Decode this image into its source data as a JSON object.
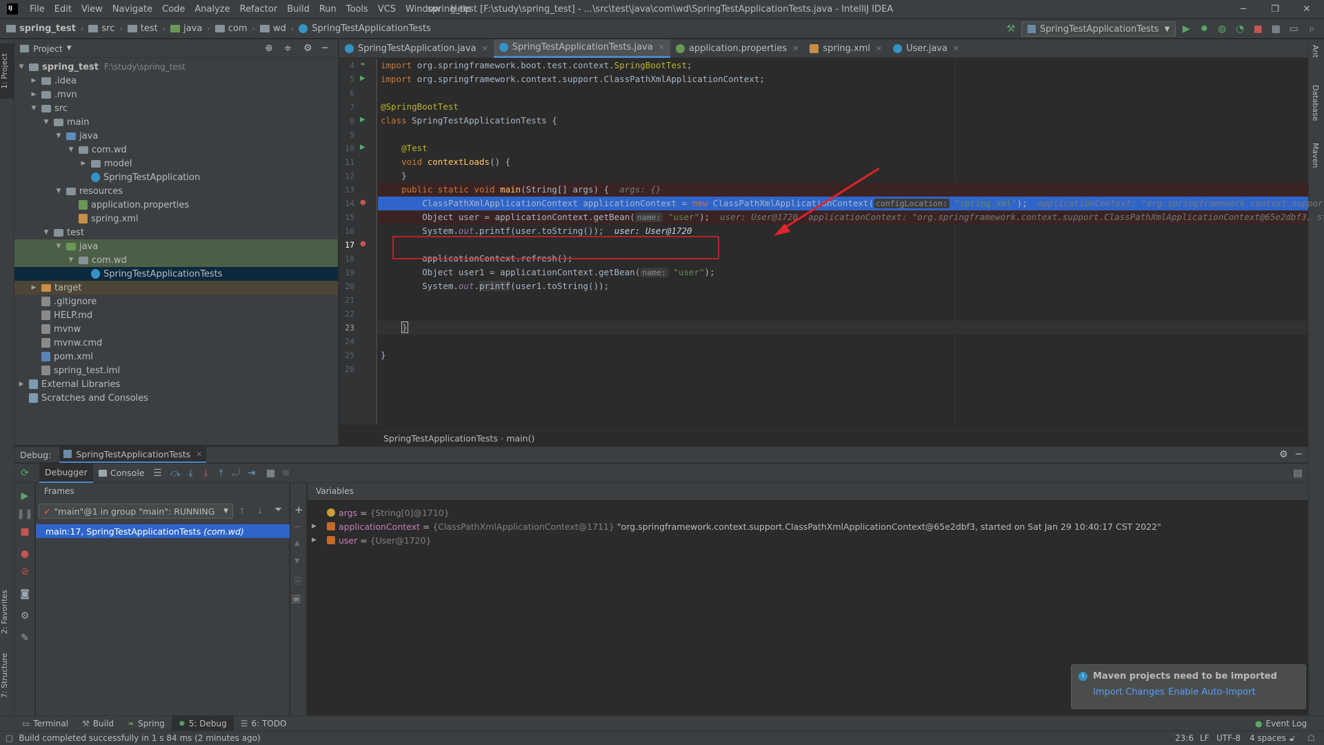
{
  "menu": [
    "File",
    "Edit",
    "View",
    "Navigate",
    "Code",
    "Analyze",
    "Refactor",
    "Build",
    "Run",
    "Tools",
    "VCS",
    "Window",
    "Help"
  ],
  "window_title": "spring_test [F:\\study\\spring_test] - ...\\src\\test\\java\\com\\wd\\SpringTestApplicationTests.java - IntelliJ IDEA",
  "navbar": {
    "crumbs": [
      "spring_test",
      "src",
      "test",
      "java",
      "com",
      "wd",
      "SpringTestApplicationTests"
    ],
    "run_config": "SpringTestApplicationTests"
  },
  "left_strip": {
    "project": "1: Project",
    "favorites": "2: Favorites",
    "structure": "7: Structure"
  },
  "right_strip": {
    "ant": "Ant",
    "database": "Database",
    "maven": "Maven"
  },
  "project": {
    "header": "Project",
    "tree": [
      {
        "label": "spring_test",
        "sub": "F:\\study\\spring_test",
        "depth": 0,
        "arrow": "open",
        "icon": "folder"
      },
      {
        "label": ".idea",
        "depth": 1,
        "arrow": "closed",
        "icon": "folder"
      },
      {
        "label": ".mvn",
        "depth": 1,
        "arrow": "closed",
        "icon": "folder"
      },
      {
        "label": "src",
        "depth": 1,
        "arrow": "open",
        "icon": "folder"
      },
      {
        "label": "main",
        "depth": 2,
        "arrow": "open",
        "icon": "folder"
      },
      {
        "label": "java",
        "depth": 3,
        "arrow": "open",
        "icon": "folder-blue"
      },
      {
        "label": "com.wd",
        "depth": 4,
        "arrow": "open",
        "icon": "folder"
      },
      {
        "label": "model",
        "depth": 5,
        "arrow": "closed",
        "icon": "folder"
      },
      {
        "label": "SpringTestApplication",
        "depth": 5,
        "arrow": "none",
        "icon": "class"
      },
      {
        "label": "resources",
        "depth": 3,
        "arrow": "open",
        "icon": "folder"
      },
      {
        "label": "application.properties",
        "depth": 4,
        "arrow": "none",
        "icon": "props"
      },
      {
        "label": "spring.xml",
        "depth": 4,
        "arrow": "none",
        "icon": "xml"
      },
      {
        "label": "test",
        "depth": 2,
        "arrow": "open",
        "icon": "folder"
      },
      {
        "label": "java",
        "depth": 3,
        "arrow": "open",
        "icon": "folder-green",
        "state": "green"
      },
      {
        "label": "com.wd",
        "depth": 4,
        "arrow": "open",
        "icon": "folder",
        "state": "green"
      },
      {
        "label": "SpringTestApplicationTests",
        "depth": 5,
        "arrow": "none",
        "icon": "class",
        "state": "selected"
      },
      {
        "label": "target",
        "depth": 1,
        "arrow": "closed",
        "icon": "folder-orange",
        "state": "target"
      },
      {
        "label": ".gitignore",
        "depth": 1,
        "arrow": "none",
        "icon": "file"
      },
      {
        "label": "HELP.md",
        "depth": 1,
        "arrow": "none",
        "icon": "file"
      },
      {
        "label": "mvnw",
        "depth": 1,
        "arrow": "none",
        "icon": "file"
      },
      {
        "label": "mvnw.cmd",
        "depth": 1,
        "arrow": "none",
        "icon": "file"
      },
      {
        "label": "pom.xml",
        "depth": 1,
        "arrow": "none",
        "icon": "maven"
      },
      {
        "label": "spring_test.iml",
        "depth": 1,
        "arrow": "none",
        "icon": "file"
      },
      {
        "label": "External Libraries",
        "depth": 0,
        "arrow": "closed",
        "icon": "library"
      },
      {
        "label": "Scratches and Consoles",
        "depth": 0,
        "arrow": "none",
        "icon": "scratch"
      }
    ]
  },
  "editor": {
    "tabs": [
      {
        "label": "SpringTestApplication.java",
        "active": false
      },
      {
        "label": "SpringTestApplicationTests.java",
        "active": true
      },
      {
        "label": "application.properties",
        "active": false
      },
      {
        "label": "spring.xml",
        "active": false
      },
      {
        "label": "User.java",
        "active": false
      }
    ],
    "line_numbers": [
      "4",
      "5",
      "6",
      "7",
      "8",
      "9",
      "10",
      "11",
      "12",
      "13",
      "14",
      "15",
      "16",
      "17",
      "18",
      "19",
      "20",
      "21",
      "22",
      "23",
      "24",
      "25",
      "26"
    ],
    "code": {
      "l4": "org.springframework.boot.test.context.",
      "l4b": "SpringBootTest",
      "l5": "org.springframework.context.support.ClassPathXmlApplicationContext;",
      "l7": "@SpringBootTest",
      "l8": "SpringTestApplicationTests {",
      "l10": "@Test",
      "l11": "contextLoads",
      "l14a": "main",
      "l14b": "(String[] args) {",
      "l14hint": "args: {}",
      "l15a": "ClassPathXmlApplicationContext applicationContext = ",
      "l15b": "ClassPathXmlApplicationContext(",
      "l15p": "configLocation:",
      "l15s": "\"spring.xml\"",
      "l15hint": "applicationContext: \"org.springframework.context.support.ClassPathX",
      "l16a": "Object user = applicationContext.getBean(",
      "l16p": "name:",
      "l16s": "\"user\"",
      "l16hint": "user: User@1720  applicationContext: \"org.springframework.context.support.ClassPathXmlApplicationContext@65e2dbf3, started on",
      "l17": "printf(user.toString());",
      "l17hint": "user: User@1720",
      "l19": "applicationContext.refresh();",
      "l20a": "Object user1 = applicationContext.getBean(",
      "l20p": "name:",
      "l20s": "\"user\"",
      "l21b": "(user1.toString());"
    },
    "crumb": [
      "SpringTestApplicationTests",
      "main()"
    ]
  },
  "debug": {
    "label": "Debug:",
    "tab": "SpringTestApplicationTests",
    "debugger_tab": "Debugger",
    "console_tab": "Console",
    "frames_title": "Frames",
    "thread": "\"main\"@1 in group \"main\": RUNNING",
    "frame": "main:17, SpringTestApplicationTests",
    "frame_pkg": "(com.wd)",
    "variables_title": "Variables",
    "variables": [
      {
        "name": "args",
        "eq": " = ",
        "type": "{String[0]@1710}",
        "value": "",
        "icon": "p"
      },
      {
        "name": "applicationContext",
        "eq": " = ",
        "type": "{ClassPathXmlApplicationContext@1711}",
        "value": "\"org.springframework.context.support.ClassPathXmlApplicationContext@65e2dbf3, started on Sat Jan 29 10:40:17 CST 2022\"",
        "icon": "f"
      },
      {
        "name": "user",
        "eq": " = ",
        "type": "{User@1720}",
        "value": "",
        "icon": "f"
      }
    ]
  },
  "bottom_tabs": [
    "Terminal",
    "Build",
    "Spring",
    "5: Debug",
    "6: TODO"
  ],
  "event_log": "Event Log",
  "status": {
    "message": "Build completed successfully in 1 s 84 ms (2 minutes ago)",
    "position": "23:6",
    "line_sep": "LF",
    "encoding": "UTF-8",
    "indent": "4 spaces"
  },
  "notification": {
    "title": "Maven projects need to be imported",
    "import": "Import Changes",
    "auto": "Enable Auto-Import"
  },
  "colors": {
    "accent": "#4a88c7",
    "selection": "#2f65ca",
    "annotation_red": "#e0242a"
  }
}
